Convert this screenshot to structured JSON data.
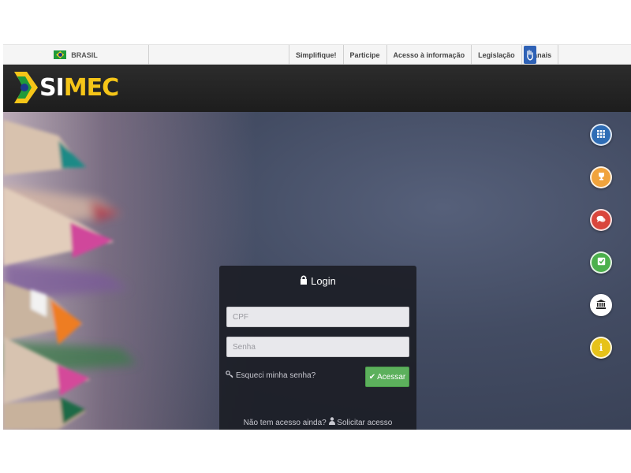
{
  "govbar": {
    "country": "BRASIL",
    "links": [
      "Simplifique!",
      "Participe",
      "Acesso à informação",
      "Legislação",
      "Canais"
    ],
    "libras_icon": "accessibility-hands-icon"
  },
  "header": {
    "logo_prefix": "SI",
    "logo_suffix": "MEC",
    "logo_icon": "simec-flag-chevron-icon"
  },
  "login": {
    "title": "Login",
    "title_icon": "lock-icon",
    "cpf_placeholder": "CPF",
    "senha_placeholder": "Senha",
    "forgot_label": "Esqueci minha senha?",
    "forgot_icon": "key-icon",
    "submit_label": "Acessar",
    "submit_icon": "check-icon",
    "no_access_text": "Não tem acesso ainda?",
    "request_label": "Solicitar acesso",
    "request_icon": "user-icon"
  },
  "side_buttons": [
    {
      "name": "apps-grid-button",
      "icon": "grid-icon",
      "color": "#2f6db5"
    },
    {
      "name": "trophy-button",
      "icon": "trophy-icon",
      "color": "#f0a33c"
    },
    {
      "name": "chat-button",
      "icon": "chat-bubbles-icon",
      "color": "#d9463c"
    },
    {
      "name": "checklist-button",
      "icon": "checkbox-icon",
      "color": "#4cb04c"
    },
    {
      "name": "institution-button",
      "icon": "bank-building-icon",
      "color": "#ffffff"
    },
    {
      "name": "info-button",
      "icon": "info-icon",
      "color": "#e6c21a"
    }
  ],
  "colors": {
    "accent_green": "#5cb05c",
    "logo_yellow": "#f5c518",
    "header_bg": "#222222"
  }
}
